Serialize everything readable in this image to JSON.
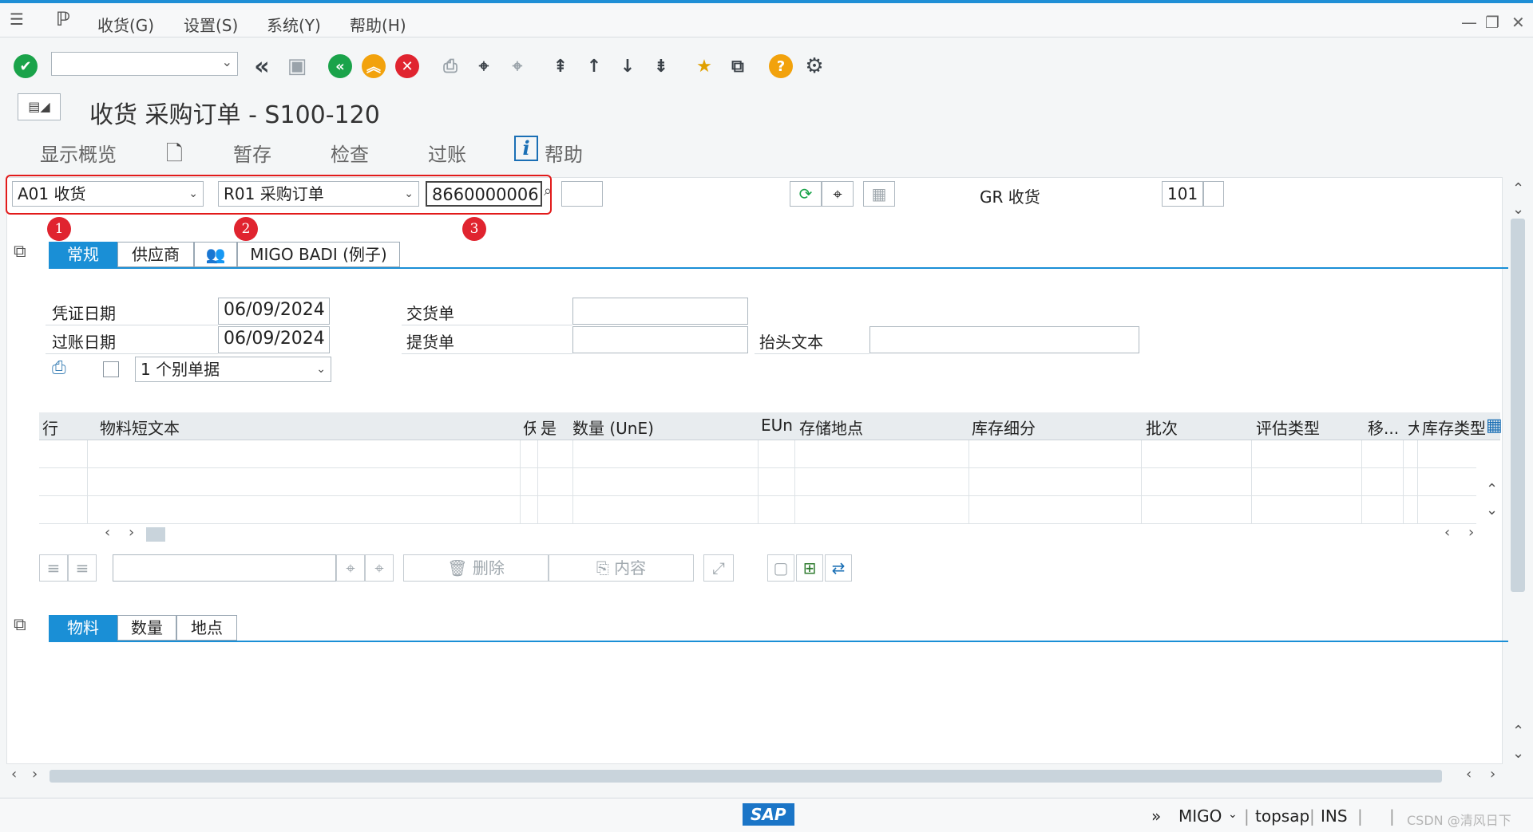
{
  "menubar": {
    "items": [
      "收货(G)",
      "设置(S)",
      "系统(Y)",
      "帮助(H)"
    ]
  },
  "toolbar": {
    "command_field_value": "",
    "icons": [
      "enter-icon",
      "back-double-icon",
      "save-icon",
      "back-icon",
      "exit-icon",
      "cancel-icon",
      "print-icon",
      "find-icon",
      "find-next-icon",
      "first-page-icon",
      "prev-page-icon",
      "next-page-icon",
      "last-page-icon",
      "create-shortcut-icon",
      "new-session-icon",
      "help-icon",
      "settings-icon"
    ]
  },
  "title": {
    "text": "收货 采购订单 - S100-120"
  },
  "apptoolbar": {
    "overview": "显示概览",
    "hold": "暂存",
    "check": "检查",
    "post": "过账",
    "help": "帮助"
  },
  "header": {
    "action": "A01 收货",
    "reference": "R01 采购订单",
    "po_number": "8660000006",
    "gr_label": "GR 收货",
    "movement_type": "101",
    "badges": [
      "1",
      "2",
      "3"
    ]
  },
  "header_tabs": {
    "tab_general": "常规",
    "tab_vendor": "供应商",
    "tab_badi": "MIGO BADI (例子)"
  },
  "general": {
    "doc_date_label": "凭证日期",
    "doc_date": "06/09/2024",
    "post_date_label": "过账日期",
    "post_date": "06/09/2024",
    "delivery_note_label": "交货单",
    "bill_of_lading_label": "提货单",
    "header_text_label": "抬头文本",
    "print_option": "1 个别单据"
  },
  "grid": {
    "columns": [
      "行",
      "物料短文本",
      "仸",
      "是",
      "数量 (UnE)",
      "EUn",
      "存储地点",
      "库存细分",
      "批次",
      "评估类型",
      "移...",
      "大",
      "库存类型"
    ]
  },
  "grid_toolbar": {
    "delete": "删除",
    "contents": "内容"
  },
  "detail_tabs": {
    "tab_material": "物料",
    "tab_quantity": "数量",
    "tab_where": "地点"
  },
  "statusbar": {
    "sap_logo": "SAP",
    "transaction": "MIGO",
    "server": "topsap",
    "mode": "INS",
    "watermark": "CSDN @清风日下"
  }
}
